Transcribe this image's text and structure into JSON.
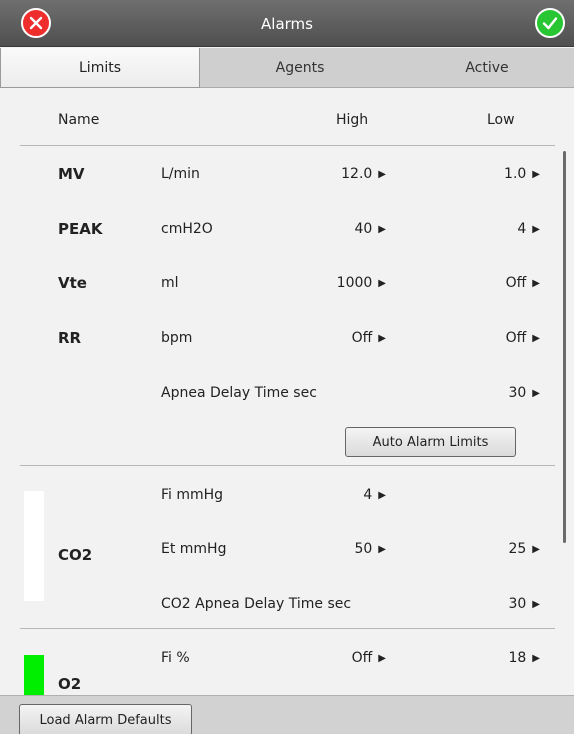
{
  "window": {
    "title": "Alarms",
    "cancel_icon": "x-circle-icon",
    "confirm_icon": "check-circle-icon",
    "colors": {
      "cancel": "#ee2d2d",
      "confirm": "#27c632"
    }
  },
  "tabs": [
    {
      "label": "Limits",
      "selected": true
    },
    {
      "label": "Agents",
      "selected": false
    },
    {
      "label": "Active",
      "selected": false
    }
  ],
  "header": {
    "name": "Name",
    "high": "High",
    "low": "Low"
  },
  "rows": {
    "mv": {
      "name": "MV",
      "unit": "L/min",
      "high": "12.0",
      "low": "1.0"
    },
    "peak": {
      "name": "PEAK",
      "unit": "cmH2O",
      "high": "40",
      "low": "4"
    },
    "vte": {
      "name": "Vte",
      "unit": "ml",
      "high": "1000",
      "low": "Off"
    },
    "rr": {
      "name": "RR",
      "unit": "bpm",
      "high": "Off",
      "low": "Off"
    },
    "apnea": {
      "label": "Apnea Delay Time  sec",
      "value": "30"
    }
  },
  "auto_alarm_button": "Auto Alarm Limits",
  "co2": {
    "name": "CO2",
    "indicator_color": "#ffffff",
    "fi": {
      "label": "Fi  mmHg",
      "high": "4"
    },
    "et": {
      "label": "Et  mmHg",
      "high": "50",
      "low": "25"
    },
    "apnea": {
      "label": "CO2 Apnea Delay Time  sec",
      "value": "30"
    }
  },
  "o2": {
    "name": "O2",
    "indicator_color": "#00ee00",
    "fi": {
      "label": "Fi  %",
      "high": "Off",
      "low": "18"
    }
  },
  "footer": {
    "load_defaults_button": "Load Alarm Defaults"
  }
}
